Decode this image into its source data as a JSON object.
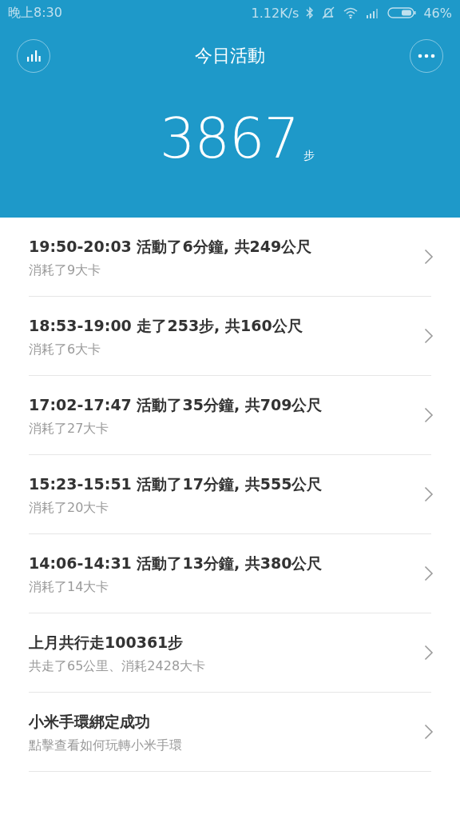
{
  "status_bar": {
    "time": "晚上8:30",
    "speed": "1.12K/s",
    "battery": "46%"
  },
  "header": {
    "title": "今日活動",
    "steps": "3867",
    "unit": "步"
  },
  "items": [
    {
      "title": "19:50-20:03 活動了6分鐘, 共249公尺",
      "subtitle": "消耗了9大卡"
    },
    {
      "title": "18:53-19:00 走了253步, 共160公尺",
      "subtitle": "消耗了6大卡"
    },
    {
      "title": "17:02-17:47 活動了35分鐘, 共709公尺",
      "subtitle": "消耗了27大卡"
    },
    {
      "title": "15:23-15:51 活動了17分鐘, 共555公尺",
      "subtitle": "消耗了20大卡"
    },
    {
      "title": "14:06-14:31 活動了13分鐘, 共380公尺",
      "subtitle": "消耗了14大卡"
    },
    {
      "title": "上月共行走100361步",
      "subtitle": "共走了65公里、消耗2428大卡"
    },
    {
      "title": "小米手環綁定成功",
      "subtitle": "點擊查看如何玩轉小米手環"
    }
  ]
}
